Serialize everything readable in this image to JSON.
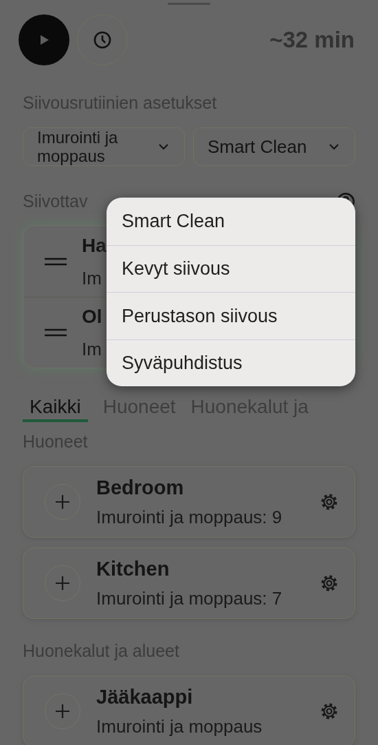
{
  "top_bar": {
    "duration": "~32 min"
  },
  "routine_settings": {
    "heading": "Siivousrutiinien asetukset",
    "dropdowns": [
      {
        "value": "Imurointi ja moppaus"
      },
      {
        "value": "Smart Clean"
      }
    ]
  },
  "areas": {
    "heading": "Siivottav",
    "items": [
      {
        "title": "Ha",
        "subtitle": "Im"
      },
      {
        "title": "Ol",
        "subtitle": "Im"
      }
    ]
  },
  "tabs": [
    {
      "label": "Kaikki",
      "selected": true
    },
    {
      "label": "Huoneet",
      "selected": false
    },
    {
      "label": "Huonekalut ja",
      "selected": false
    }
  ],
  "sections": [
    {
      "heading": "Huoneet",
      "items": [
        {
          "title": "Bedroom",
          "subtitle": "Imurointi ja moppaus: 9"
        },
        {
          "title": "Kitchen",
          "subtitle": "Imurointi ja moppaus: 7"
        }
      ]
    },
    {
      "heading": "Huonekalut ja alueet",
      "items": [
        {
          "title": "Jääkaappi",
          "subtitle": "Imurointi ja moppaus"
        }
      ]
    }
  ],
  "menu": {
    "items": [
      {
        "label": "Smart Clean"
      },
      {
        "label": "Kevyt siivous"
      },
      {
        "label": "Perustason siivous"
      },
      {
        "label": "Syväpuhdistus"
      }
    ]
  }
}
